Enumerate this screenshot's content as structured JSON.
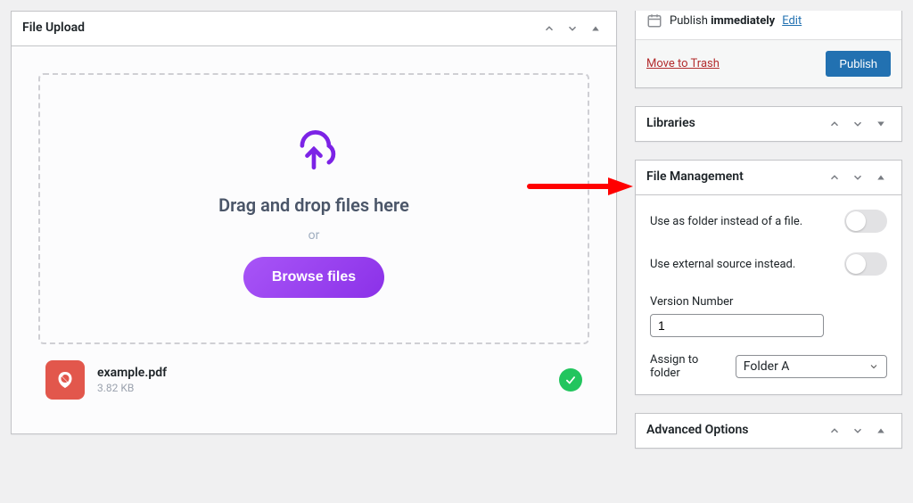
{
  "file_upload": {
    "title": "File Upload",
    "drop_title": "Drag and drop files here",
    "or": "or",
    "browse": "Browse files",
    "file": {
      "name": "example.pdf",
      "size": "3.82 KB"
    }
  },
  "publish": {
    "schedule_prefix": "Publish ",
    "schedule_emph": "immediately",
    "edit": "Edit",
    "trash": "Move to Trash",
    "button": "Publish"
  },
  "libraries": {
    "title": "Libraries"
  },
  "file_mgmt": {
    "title": "File Management",
    "folder_toggle_label": "Use as folder instead of a file.",
    "external_toggle_label": "Use external source instead.",
    "version_label": "Version Number",
    "version_value": "1",
    "assign_label": "Assign to folder",
    "assign_value": "Folder A"
  },
  "advanced": {
    "title": "Advanced Options"
  }
}
